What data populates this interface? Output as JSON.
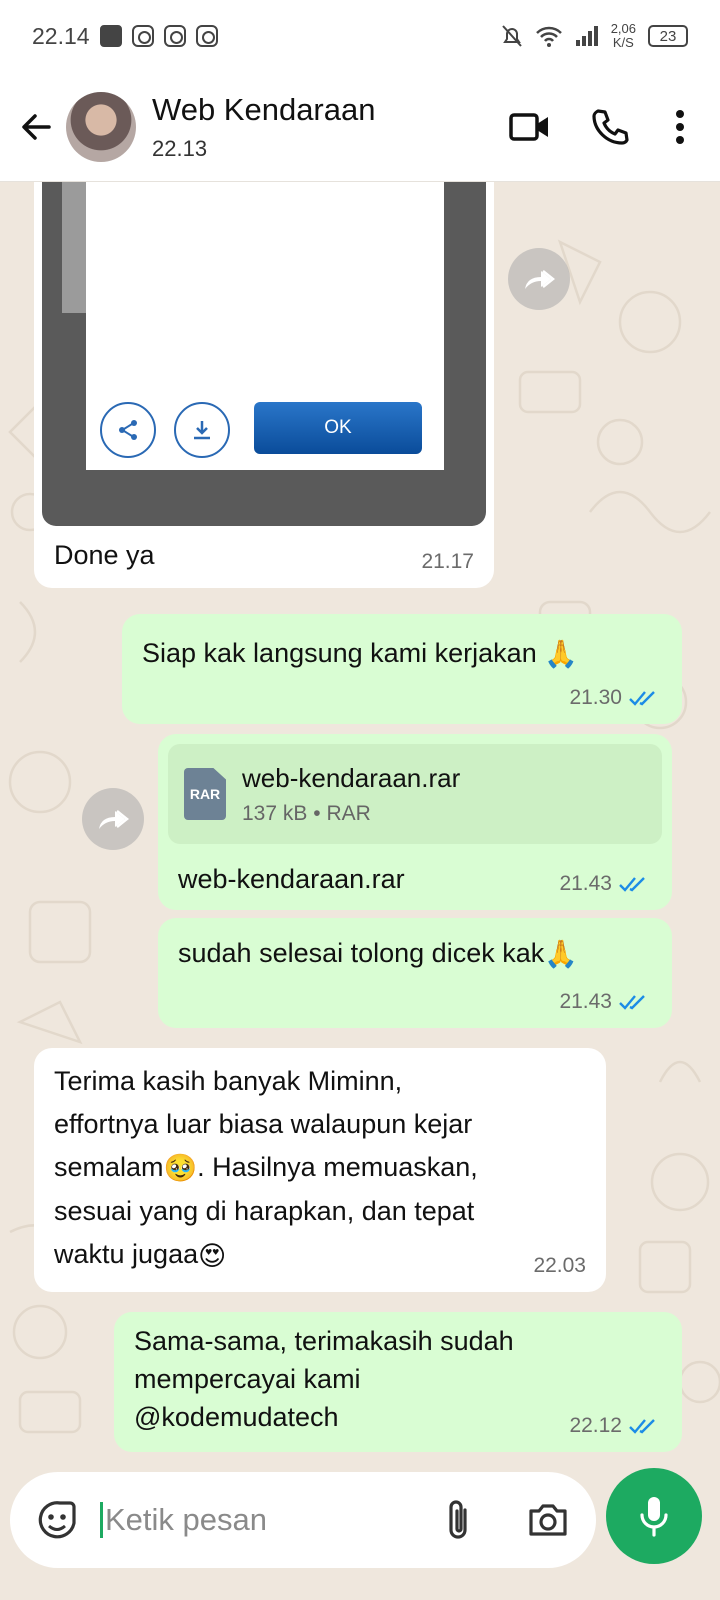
{
  "status_bar": {
    "time": "22.14",
    "speed_value": "2,06",
    "speed_unit": "K/S",
    "battery": "23"
  },
  "header": {
    "contact_name": "Web Kendaraan",
    "last_seen": "22.13"
  },
  "messages": [
    {
      "id": "m1",
      "direction": "in",
      "type": "image",
      "image_button": "OK",
      "caption": "Done ya",
      "time": "21.17"
    },
    {
      "id": "m2",
      "direction": "out",
      "type": "text",
      "text": "Siap kak langsung kami kerjakan",
      "emoji": "🙏",
      "time": "21.30",
      "read": true
    },
    {
      "id": "m3",
      "direction": "out",
      "type": "file",
      "file_name": "web-kendaraan.rar",
      "file_type": "RAR",
      "file_size": "137 kB",
      "meta_sep": "•",
      "caption": "web-kendaraan.rar",
      "time": "21.43",
      "read": true
    },
    {
      "id": "m4",
      "direction": "out",
      "type": "text",
      "text": "sudah selesai tolong dicek kak",
      "emoji": "🙏",
      "time": "21.43",
      "read": true
    },
    {
      "id": "m5",
      "direction": "in",
      "type": "text",
      "lines": [
        "Terima kasih banyak Miminn,",
        "effortnya luar biasa walaupun kejar",
        "semalam",
        ". Hasilnya memuaskan,",
        "sesuai yang di harapkan, dan tepat",
        "waktu jugaa"
      ],
      "emoji_1": "🥹",
      "emoji_2": "😍",
      "time": "22.03"
    },
    {
      "id": "m6",
      "direction": "out",
      "type": "text",
      "lines": [
        "Sama-sama, terimakasih sudah",
        "mempercayai kami",
        "@kodemudatech"
      ],
      "time": "22.12",
      "read": true
    }
  ],
  "input": {
    "placeholder": "Ketik pesan"
  },
  "colors": {
    "outgoing_bubble": "#d9fdd3",
    "incoming_bubble": "#ffffff",
    "chat_background": "#efe7dd",
    "read_ticks": "#1c8ce6",
    "accent": "#1daa61"
  },
  "icons": [
    "back-arrow-icon",
    "video-call-icon",
    "voice-call-icon",
    "more-vert-icon",
    "forward-icon",
    "read-receipt-icon",
    "emoji-sticker-icon",
    "attach-icon",
    "camera-icon",
    "mic-icon",
    "rar-file-icon",
    "share-icon",
    "download-icon"
  ]
}
